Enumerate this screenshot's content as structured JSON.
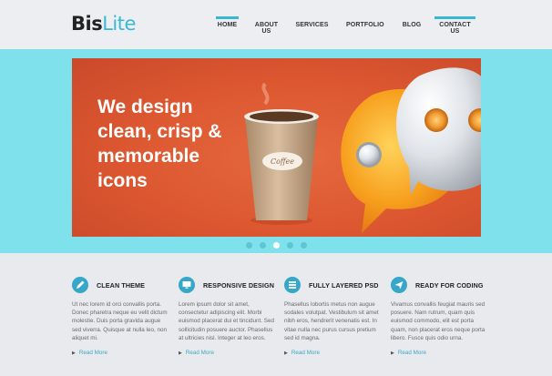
{
  "logo": {
    "part1": "Bis",
    "part2": "Lite"
  },
  "nav": {
    "items": [
      {
        "label": "HOME",
        "active": true
      },
      {
        "label": "ABOUT US",
        "active": false
      },
      {
        "label": "SERVICES",
        "active": false
      },
      {
        "label": "PORTFOLIO",
        "active": false
      },
      {
        "label": "BLOG",
        "active": false
      },
      {
        "label": "CONTACT US",
        "active": true
      }
    ]
  },
  "hero": {
    "headline": "We design clean, crisp & memorable icons",
    "cup_label": "Coffee",
    "slide_count": 5,
    "active_slide": 3
  },
  "features": [
    {
      "icon": "pen-icon",
      "title": "CLEAN THEME",
      "text": "Ut nec lorem id orci convallis porta. Donec pharetra neque eu velit dictum molestie. Duis porta gravida augue sed viverra. Quisque at nulla leo, non aliquet mi.",
      "more": "Read More"
    },
    {
      "icon": "monitor-icon",
      "title": "RESPONSIVE DESIGN",
      "text": "Lorem ipsum dolor sit amet, consectetur adipiscing elit. Morbi euismod placerat dui et tincidunt. Sed sollicitudin posuere auctor. Phasellus at ultricies nisl. Integer at leo eros.",
      "more": "Read More"
    },
    {
      "icon": "layers-icon",
      "title": "FULLY LAYERED PSD",
      "text": "Phasellus lobortis metus non augue sodales volutpat. Vestibulum sit amet nibh eros, hendrerit venenatis est. In vitae nulla nec purus cursus pretium sed id magna.",
      "more": "Read More"
    },
    {
      "icon": "paper-plane-icon",
      "title": "READY FOR CODING",
      "text": "Vivamus convallis feugiat mauris sed posuere. Nam rutrum, quam quis euismod commodo, elit est porta quam, non placerat eros neque porta libero. Fusce quis odio urna.",
      "more": "Read More"
    }
  ],
  "colors": {
    "accent": "#37b9d3",
    "band": "#7ee1ec",
    "slide": "#dc5730"
  }
}
